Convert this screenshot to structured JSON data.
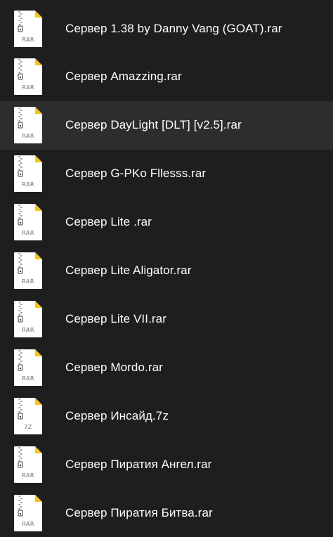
{
  "files": [
    {
      "name": "Сервер 1.38 by Danny Vang (GOAT).rar",
      "ext": "RAR",
      "icon": "rar-archive-icon"
    },
    {
      "name": "Сервер Amazzing.rar",
      "ext": "RAR",
      "icon": "rar-archive-icon"
    },
    {
      "name": "Сервер DayLight [DLT] [v2.5].rar",
      "ext": "RAR",
      "icon": "rar-archive-icon",
      "selected": true
    },
    {
      "name": "Сервер G-PKo Fllesss.rar",
      "ext": "RAR",
      "icon": "rar-archive-icon"
    },
    {
      "name": "Сервер Lite .rar",
      "ext": "RAR",
      "icon": "rar-archive-icon"
    },
    {
      "name": "Сервер Lite Aligator.rar",
      "ext": "RAR",
      "icon": "rar-archive-icon"
    },
    {
      "name": "Сервер Lite VII.rar",
      "ext": "RAR",
      "icon": "rar-archive-icon"
    },
    {
      "name": "Сервер Mordo.rar",
      "ext": "RAR",
      "icon": "rar-archive-icon"
    },
    {
      "name": "Сервер Инсайд.7z",
      "ext": "7Z",
      "icon": "7z-archive-icon"
    },
    {
      "name": "Сервер Пиратия Ангел.rar",
      "ext": "RAR",
      "icon": "rar-archive-icon"
    },
    {
      "name": "Сервер Пиратия Битва.rar",
      "ext": "RAR",
      "icon": "rar-archive-icon"
    }
  ],
  "colors": {
    "background": "#1e1e1f",
    "selected_row": "#2d2d2e",
    "text": "#ffffff",
    "icon_paper": "#ffffff",
    "icon_fold": "#f5c518",
    "ext_label": "#6e6e6e"
  }
}
